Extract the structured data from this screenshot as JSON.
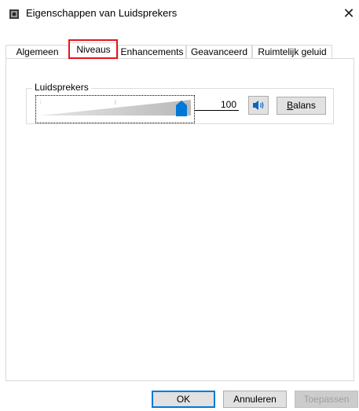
{
  "window": {
    "title": "Eigenschappen van Luidsprekers",
    "close_symbol": "✕"
  },
  "tabs": [
    {
      "label": "Algemeen",
      "active": false
    },
    {
      "label": "Niveaus",
      "active": true
    },
    {
      "label": "Enhancements",
      "active": false
    },
    {
      "label": "Geavanceerd",
      "active": false
    },
    {
      "label": "Ruimtelijk geluid",
      "active": false
    }
  ],
  "levels": {
    "group_label": "Luidsprekers",
    "volume_value": "100",
    "volume_fraction": 1.0,
    "balance_label": "Balans"
  },
  "footer": {
    "ok_label": "OK",
    "cancel_label": "Annuleren",
    "apply_label": "Toepassen"
  },
  "icons": {
    "app": "speaker-properties-icon",
    "mute": "speaker-volume-icon"
  },
  "colors": {
    "accent": "#0078d7",
    "highlight_box": "#e8141c"
  }
}
